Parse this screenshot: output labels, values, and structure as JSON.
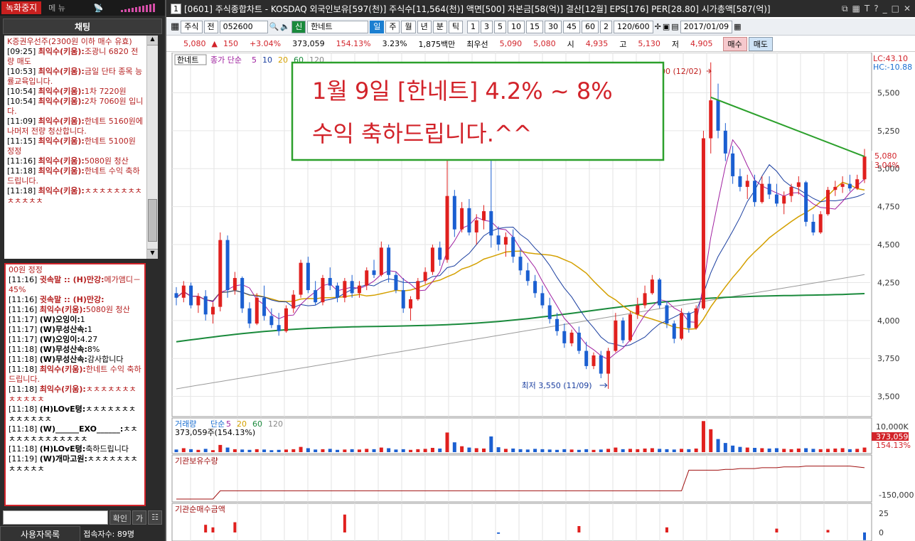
{
  "left_panel": {
    "record_button": "녹화중지",
    "menu_label": "메 뉴",
    "chat_title": "채팅",
    "chat_top_messages": [
      {
        "time": "",
        "user": "",
        "text": "K증권우선주(2300원 이하 매수 유효)"
      },
      {
        "time": "[09:25]",
        "user": "최익수(키움):",
        "text": "조광니 6820 전량 매도"
      },
      {
        "time": "[10:53]",
        "user": "최익수(키움):",
        "text": "금일 단타 종목 능률교육입니다."
      },
      {
        "time": "[10:54]",
        "user": "최익수(키움):",
        "text": "1차 7220원"
      },
      {
        "time": "[10:54]",
        "user": "최익수(키움):",
        "text": "2차 7060원 입니다."
      },
      {
        "time": "[11:09]",
        "user": "최익수(키움):",
        "text": "한네트 5160원에 나머저 전량 청산합니다."
      },
      {
        "time": "[11:15]",
        "user": "최익수(키움):",
        "text": "한네트 5100원 정정"
      },
      {
        "time": "[11:16]",
        "user": "최익수(키움):",
        "text": "5080원 청산"
      },
      {
        "time": "[11:18]",
        "user": "최익수(키움):",
        "text": "한네트 수익 축하드립니다."
      },
      {
        "time": "[11:18]",
        "user": "최익수(키움):",
        "text": "ㅊㅊㅊㅊㅊㅊㅊㅊㅊㅊㅊㅊㅊ"
      }
    ],
    "chat_bottom_messages": [
      {
        "time": "",
        "user": "",
        "text": "00원 정정",
        "red": true
      },
      {
        "time": "[11:16]",
        "user": "귓속말 :: (H)만강:",
        "text": "메가앰디－45%",
        "red": true
      },
      {
        "time": "[11:16]",
        "user": "귓속말 :: (H)만강:",
        "text": "",
        "red": true
      },
      {
        "time": "[11:16]",
        "user": "최익수(키움):",
        "text": "5080원 청산",
        "red": true
      },
      {
        "time": "[11:17]",
        "user": "(W)오잉이:",
        "text": "1",
        "red": false
      },
      {
        "time": "[11:17]",
        "user": "(W)무성산속:",
        "text": "1",
        "red": false
      },
      {
        "time": "[11:17]",
        "user": "(W)오잉이:",
        "text": "4.27",
        "red": false
      },
      {
        "time": "[11:18]",
        "user": "(W)무성산속:",
        "text": "8%",
        "red": false
      },
      {
        "time": "[11:18]",
        "user": "(W)무성산속:",
        "text": "감사합니다",
        "red": false
      },
      {
        "time": "[11:18]",
        "user": "최익수(키움):",
        "text": "한네트 수익 축하드립니다.",
        "red": true
      },
      {
        "time": "[11:18]",
        "user": "최익수(키움):",
        "text": "ㅊㅊㅊㅊㅊㅊㅊㅊㅊㅊㅊㅊ",
        "red": true
      },
      {
        "time": "[11:18]",
        "user": "(H)LOvE텽:",
        "text": "ㅊㅊㅊㅊㅊㅊㅊㅊㅊㅊㅊㅊㅊ",
        "red": false
      },
      {
        "time": "[11:18]",
        "user": "(W)______EXO______:",
        "text": "ㅊㅊㅊㅊㅊㅊㅊㅊㅊㅊㅊㅊㅊ",
        "red": false
      },
      {
        "time": "[11:18]",
        "user": "(H)LOvE텽:",
        "text": "축하드립니다",
        "red": false
      },
      {
        "time": "[11:19]",
        "user": "(W)개마고원:",
        "text": "ㅊㅊㅊㅊㅊㅊㅊㅊㅊㅊㅊㅊ",
        "red": false
      }
    ],
    "confirm_button": "확인",
    "ga_button": "가",
    "users_button": "사용자목록",
    "users_count": "접속자수: 89명"
  },
  "window": {
    "number": "1",
    "title": "[0601] 주식종합차트 - KOSDAQ 외국인보유[597(천)] 주식수[11,564(천)] 액면[500] 자본금[58(억)] 결산[12월] EPS[176] PER[28.80] 시가총액[587(억)]"
  },
  "toolbar": {
    "market": "주식",
    "jeon": "전",
    "code": "052600",
    "new_label": "신",
    "stock_name": "한네트",
    "periods": [
      "일",
      "주",
      "월",
      "년",
      "분",
      "틱"
    ],
    "intervals": [
      "1",
      "3",
      "5",
      "10",
      "15",
      "30",
      "45",
      "60"
    ],
    "count_select": "2",
    "range": "120/600",
    "date": "2017/01/09"
  },
  "quote": {
    "price": "5,080",
    "change": "150",
    "pct": "+3.04%",
    "volume": "373,059",
    "vol_ratio": "154.13%",
    "turnover": "3.23%",
    "amount": "1,875백만",
    "pref_label": "최우선",
    "ask": "5,090",
    "bid": "5,080",
    "open_label": "시",
    "open": "4,935",
    "high_label": "고",
    "high": "5,130",
    "low_label": "저",
    "low": "4,905",
    "buy": "매수",
    "sell": "매도"
  },
  "chart_data": {
    "type": "candlestick",
    "stock_tab": "한네트",
    "price_legend": [
      "종가 단순",
      "5",
      "10",
      "20",
      "60",
      "120"
    ],
    "y_ticks": [
      "5,500",
      "5,250",
      "5,000",
      "4,750",
      "4,500",
      "4,250",
      "4,000",
      "3,750",
      "3,500"
    ],
    "ylim": [
      3400,
      5680
    ],
    "lc": "LC:43.10",
    "hc": "HC:-10.88",
    "last_price_label": "5,080",
    "last_pct_label": "3.04%",
    "high_annotation": "최고 5,700 (12/02)",
    "low_annotation": "최저 3,550 (11/09)",
    "overlay_line1": "1월 9일 [한네트] 4.2% ~ 8%",
    "overlay_line2": "수익 축하드립니다.^^",
    "candles": [
      [
        4180,
        4220,
        4100,
        4150
      ],
      [
        4150,
        4260,
        4120,
        4230
      ],
      [
        4230,
        4250,
        4080,
        4100
      ],
      [
        4100,
        4180,
        4050,
        4160
      ],
      [
        4160,
        4200,
        4000,
        4040
      ],
      [
        4040,
        4120,
        3980,
        4090
      ],
      [
        4090,
        4580,
        4060,
        4530
      ],
      [
        4530,
        4560,
        4150,
        4200
      ],
      [
        4200,
        4320,
        4170,
        4280
      ],
      [
        4280,
        4290,
        4050,
        4080
      ],
      [
        4080,
        4120,
        3950,
        3980
      ],
      [
        3980,
        4180,
        3970,
        4150
      ],
      [
        4150,
        4230,
        4000,
        4030
      ],
      [
        4030,
        4080,
        3950,
        3970
      ],
      [
        3970,
        4050,
        3900,
        3930
      ],
      [
        3930,
        4100,
        3920,
        4080
      ],
      [
        4080,
        4200,
        4050,
        4170
      ],
      [
        4170,
        4400,
        4150,
        4380
      ],
      [
        4380,
        4420,
        4180,
        4200
      ],
      [
        4200,
        4260,
        4100,
        4120
      ],
      [
        4120,
        4300,
        4100,
        4280
      ],
      [
        4280,
        4350,
        4200,
        4230
      ],
      [
        4230,
        4250,
        4120,
        4150
      ],
      [
        4150,
        4280,
        4120,
        4260
      ],
      [
        4260,
        4300,
        4150,
        4180
      ],
      [
        4180,
        4260,
        4150,
        4230
      ],
      [
        4230,
        4350,
        4200,
        4330
      ],
      [
        4330,
        4400,
        4280,
        4300
      ],
      [
        4300,
        4520,
        4290,
        4480
      ],
      [
        4480,
        4500,
        4250,
        4300
      ],
      [
        4300,
        4320,
        4180,
        4200
      ],
      [
        4200,
        4280,
        4050,
        4080
      ],
      [
        4080,
        4160,
        4000,
        4140
      ],
      [
        4140,
        4280,
        4130,
        4260
      ],
      [
        4260,
        4350,
        4240,
        4320
      ],
      [
        4320,
        4500,
        4300,
        4480
      ],
      [
        4480,
        4520,
        4360,
        4400
      ],
      [
        4400,
        5550,
        4380,
        4820
      ],
      [
        4820,
        4860,
        4550,
        4600
      ],
      [
        4600,
        4780,
        4580,
        4740
      ],
      [
        4740,
        4800,
        4560,
        4580
      ],
      [
        4580,
        4700,
        4500,
        4660
      ],
      [
        4660,
        4760,
        4600,
        4720
      ],
      [
        4720,
        5500,
        4480,
        4560
      ],
      [
        4560,
        4620,
        4460,
        4500
      ],
      [
        4500,
        4580,
        4420,
        4550
      ],
      [
        4550,
        4600,
        4380,
        4420
      ],
      [
        4420,
        4480,
        4300,
        4330
      ],
      [
        4330,
        4380,
        4230,
        4260
      ],
      [
        4260,
        4300,
        4150,
        4180
      ],
      [
        4180,
        4230,
        4080,
        4100
      ],
      [
        4100,
        4150,
        3980,
        4010
      ],
      [
        4010,
        4050,
        3900,
        3930
      ],
      [
        3930,
        3980,
        3820,
        3850
      ],
      [
        3850,
        3940,
        3830,
        3920
      ],
      [
        3920,
        3960,
        3780,
        3800
      ],
      [
        3800,
        3860,
        3680,
        3700
      ],
      [
        3700,
        3790,
        3680,
        3770
      ],
      [
        3770,
        3800,
        3620,
        3650
      ],
      [
        3650,
        3820,
        3550,
        3800
      ],
      [
        3800,
        4050,
        3790,
        4000
      ],
      [
        4000,
        4020,
        3850,
        3870
      ],
      [
        3870,
        4060,
        3860,
        4040
      ],
      [
        4040,
        4150,
        4010,
        4100
      ],
      [
        4100,
        4230,
        4080,
        4180
      ],
      [
        4180,
        4300,
        4170,
        4270
      ],
      [
        4270,
        4280,
        4080,
        4100
      ],
      [
        4100,
        4130,
        3950,
        3980
      ],
      [
        3980,
        4000,
        3850,
        3880
      ],
      [
        3880,
        4080,
        3870,
        4050
      ],
      [
        4050,
        4060,
        3920,
        3950
      ],
      [
        3950,
        4100,
        3940,
        4080
      ],
      [
        4080,
        5250,
        4070,
        5200
      ],
      [
        5200,
        5700,
        5100,
        5450
      ],
      [
        5450,
        5560,
        5200,
        5250
      ],
      [
        5250,
        5300,
        5050,
        5100
      ],
      [
        5100,
        5150,
        4900,
        4950
      ],
      [
        4950,
        5000,
        4850,
        4880
      ],
      [
        4880,
        4960,
        4800,
        4920
      ],
      [
        4920,
        4960,
        4750,
        4780
      ],
      [
        4780,
        4950,
        4770,
        4900
      ],
      [
        4900,
        4950,
        4800,
        4830
      ],
      [
        4830,
        4900,
        4750,
        4770
      ],
      [
        4770,
        4850,
        4700,
        4820
      ],
      [
        4820,
        4900,
        4780,
        4880
      ],
      [
        4880,
        4950,
        4830,
        4910
      ],
      [
        4910,
        4920,
        4620,
        4650
      ],
      [
        4650,
        4700,
        4560,
        4580
      ],
      [
        4580,
        4720,
        4570,
        4700
      ],
      [
        4700,
        4880,
        4690,
        4860
      ],
      [
        4860,
        4920,
        4820,
        4880
      ],
      [
        4880,
        4950,
        4840,
        4900
      ],
      [
        4900,
        4960,
        4850,
        4870
      ],
      [
        4870,
        4960,
        4860,
        4930
      ],
      [
        4930,
        5130,
        4905,
        5080
      ]
    ],
    "volume_legend": [
      "거래량",
      "단순",
      "5",
      "20",
      "60",
      "120"
    ],
    "volume_value": "373,059주(154.13%)",
    "volume_ticks": [
      "10,000K"
    ],
    "volume_last": "373,059",
    "volume_pct": "154.13%",
    "volumes": [
      8,
      12,
      9,
      7,
      10,
      6,
      22,
      14,
      9,
      8,
      7,
      9,
      8,
      6,
      7,
      8,
      9,
      16,
      12,
      8,
      9,
      10,
      7,
      8,
      9,
      8,
      10,
      9,
      14,
      12,
      8,
      9,
      7,
      9,
      10,
      13,
      11,
      60,
      30,
      18,
      14,
      12,
      11,
      48,
      15,
      10,
      11,
      9,
      8,
      10,
      9,
      8,
      7,
      9,
      8,
      7,
      9,
      7,
      8,
      10,
      14,
      9,
      10,
      9,
      11,
      12,
      10,
      9,
      8,
      10,
      9,
      11,
      95,
      70,
      40,
      28,
      20,
      16,
      14,
      13,
      12,
      11,
      12,
      10,
      9,
      11,
      12,
      10,
      9,
      10,
      11,
      12,
      9,
      10,
      14
    ],
    "inst_hold_label": "기관보유수량",
    "inst_hold_tick": "-150,000",
    "inst_hold": [
      0,
      0,
      0,
      0,
      0,
      0,
      20,
      20,
      20,
      20,
      20,
      20,
      20,
      20,
      20,
      20,
      20,
      20,
      20,
      20,
      20,
      20,
      20,
      20,
      20,
      20,
      20,
      20,
      20,
      20,
      20,
      20,
      20,
      20,
      20,
      20,
      20,
      20,
      20,
      20,
      20,
      20,
      20,
      20,
      20,
      20,
      20,
      20,
      20,
      20,
      20,
      20,
      20,
      20,
      20,
      20,
      20,
      20,
      20,
      20,
      20,
      20,
      20,
      20,
      20,
      20,
      20,
      20,
      20,
      20,
      70,
      70,
      70,
      70,
      70,
      72,
      72,
      74,
      74,
      74,
      76,
      76,
      76,
      78,
      78,
      78,
      80,
      80,
      80,
      80,
      80,
      80,
      80,
      78,
      76
    ],
    "inst_net_label": "기관순매수금액",
    "inst_net_ticks": [
      "25",
      "0"
    ],
    "inst_net": [
      0,
      0,
      0,
      0,
      6,
      4,
      0,
      0,
      8,
      0,
      0,
      0,
      0,
      0,
      0,
      0,
      0,
      0,
      0,
      0,
      0,
      0,
      0,
      14,
      0,
      0,
      0,
      0,
      0,
      0,
      0,
      0,
      0,
      0,
      0,
      0,
      0,
      0,
      0,
      0,
      0,
      0,
      0,
      0,
      -1,
      0,
      0,
      0,
      0,
      0,
      0,
      0,
      0,
      0,
      0,
      5,
      0,
      0,
      0,
      0,
      0,
      0,
      0,
      0,
      0,
      0,
      0,
      4,
      0,
      0,
      0,
      0,
      0,
      0,
      0,
      0,
      0,
      0,
      0,
      0,
      0,
      0,
      3,
      0,
      0,
      0,
      0,
      0,
      0,
      2,
      0,
      0,
      0,
      0,
      -6
    ]
  }
}
